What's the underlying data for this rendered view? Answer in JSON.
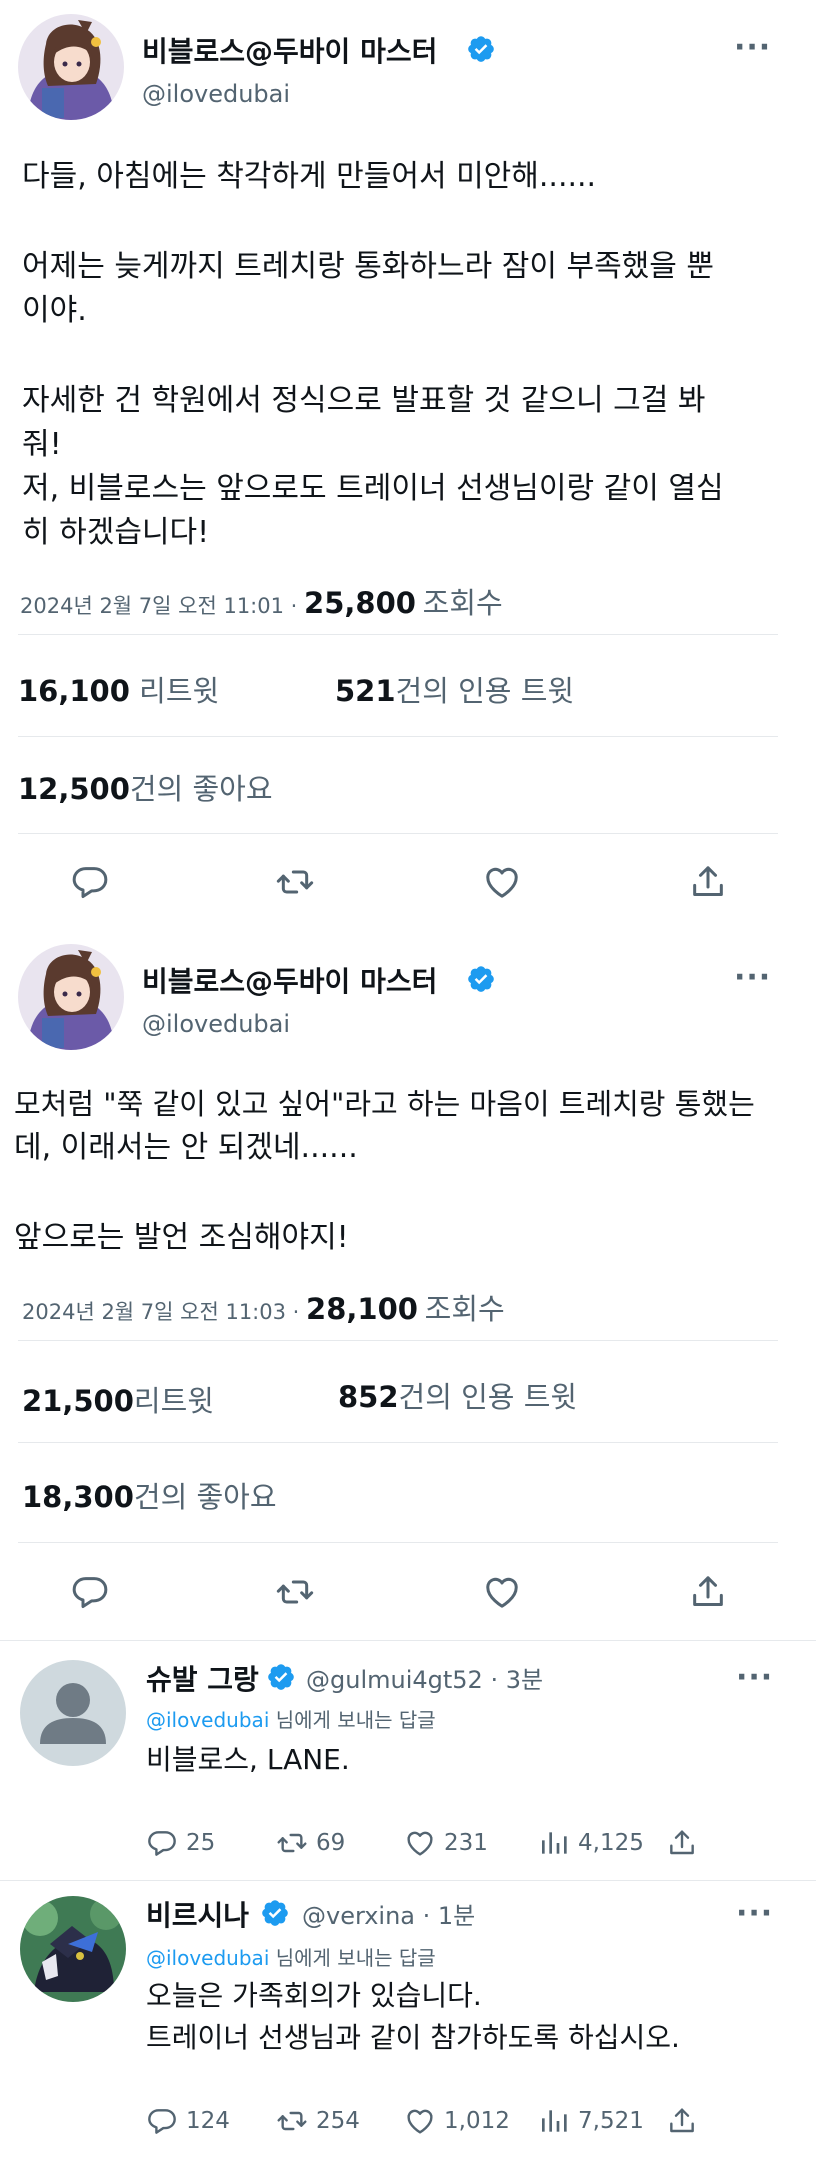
{
  "tweet1": {
    "name": "비블로스@두바이 마스터",
    "handle": "@ilovedubai",
    "lines": [
      "다들, 아침에는 착각하게 만들어서 미안해......",
      "",
      "어제는 늦게까지 트레치랑 통화하느라 잠이 부족했을 뿐",
      "이야.",
      "",
      "자세한 건 학원에서 정식으로 발표할 것 같으니 그걸 봐",
      "줘!",
      "저, 비블로스는 앞으로도 트레이너 선생님이랑 같이 열심",
      "히 하겠습니다!"
    ],
    "timestamp": "2024년 2월 7일 오전 11:01 ·",
    "views_count": "25,800",
    "views_label": "조회수",
    "retweets_count": "16,100",
    "retweets_label": "리트윗",
    "quotes_count": "521",
    "quotes_label": "건의 인용 트윗",
    "likes_count": "12,500",
    "likes_label": "건의 좋아요"
  },
  "tweet2": {
    "name": "비블로스@두바이 마스터",
    "handle": "@ilovedubai",
    "lines": [
      "모처럼 \"쭉 같이 있고 싶어\"라고 하는 마음이 트레치랑 통했는",
      "데, 이래서는 안 되겠네......",
      "",
      "앞으로는 발언 조심해야지!"
    ],
    "timestamp": "2024년 2월 7일 오전 11:03 ·",
    "views_count": "28,100",
    "views_label": "조회수",
    "retweets_count": "21,500",
    "retweets_label": "리트윗",
    "quotes_count": "852",
    "quotes_label": "건의 인용 트윗",
    "likes_count": "18,300",
    "likes_label": "건의 좋아요"
  },
  "reply1": {
    "name": "슈발 그랑",
    "handle": "@gulmui4gt52 · 3분",
    "reply_to_mention": "@ilovedubai",
    "reply_to_suffix": " 님에게 보내는 답글",
    "text": "비블로스, LANE.",
    "replies": "25",
    "retweets": "69",
    "likes": "231",
    "views": "4,125"
  },
  "reply2": {
    "name": "비르시나",
    "handle": "@verxina · 1분",
    "reply_to_mention": "@ilovedubai",
    "reply_to_suffix": " 님에게 보내는 답글",
    "lines": [
      "오늘은 가족회의가 있습니다.",
      "트레이너 선생님과 같이 참가하도록 하십시오."
    ],
    "replies": "124",
    "retweets": "254",
    "likes": "1,012",
    "views": "7,521"
  },
  "colors": {
    "verified": "#1d9bf0",
    "text": "#0f1419",
    "secondary": "#536471",
    "divider": "#e6e9ec"
  },
  "icons": [
    "more-icon",
    "verified-icon",
    "reply-icon",
    "retweet-icon",
    "like-icon",
    "share-icon",
    "views-icon",
    "avatar-placeholder-icon"
  ]
}
